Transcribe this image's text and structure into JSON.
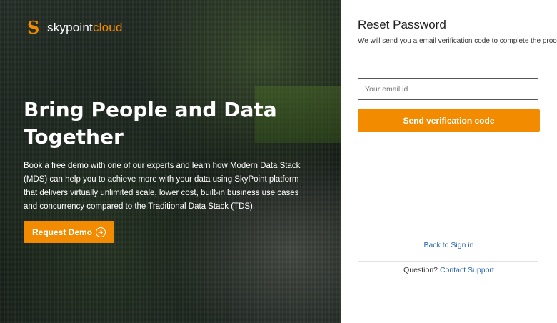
{
  "brand": {
    "mark": "S",
    "name_prefix": "skypoint",
    "name_suffix": "cloud",
    "accent": "#f28b00"
  },
  "hero": {
    "headline": "Bring People and Data Together",
    "description": "Book a free demo with one of our experts and learn how Modern Data Stack (MDS) can help you to achieve more with your data using SkyPoint platform that delivers virtually unlimited scale, lower cost, built-in business use cases and concurrency compared to the Traditional Data Stack (TDS).",
    "demo_button_label": "Request Demo",
    "demo_button_icon": "arrow-right-circle-icon"
  },
  "form": {
    "title": "Reset Password",
    "subtitle": "We will send you a email verification code to complete the process",
    "email_placeholder": "Your email id",
    "email_value": "",
    "send_button_label": "Send verification code",
    "back_link": "Back to Sign in",
    "question_text": "Question?",
    "support_link": "Contact Support"
  },
  "colors": {
    "link": "#2a66b2",
    "button": "#f28b00"
  }
}
